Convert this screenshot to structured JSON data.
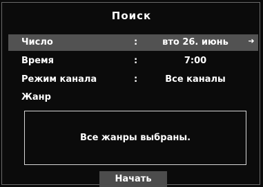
{
  "dialog": {
    "title": "Поиск"
  },
  "fields": [
    {
      "label": "Число",
      "separator": ":",
      "value": "вто 26. июнь",
      "selected": true,
      "arrow_icon": "arrow-right-icon"
    },
    {
      "label": "Время",
      "separator": ":",
      "value": "7:00",
      "selected": false
    },
    {
      "label": "Режим канала",
      "separator": ":",
      "value": "Все каналы",
      "selected": false
    },
    {
      "label": "Жанр",
      "selected": false
    }
  ],
  "genre": {
    "status": "Все жанры выбраны."
  },
  "actions": {
    "start_label": "Начать"
  },
  "colors": {
    "background": "#0b0b0b",
    "highlight": "#525252",
    "button": "#4c4c4c",
    "text": "#ffffff"
  }
}
